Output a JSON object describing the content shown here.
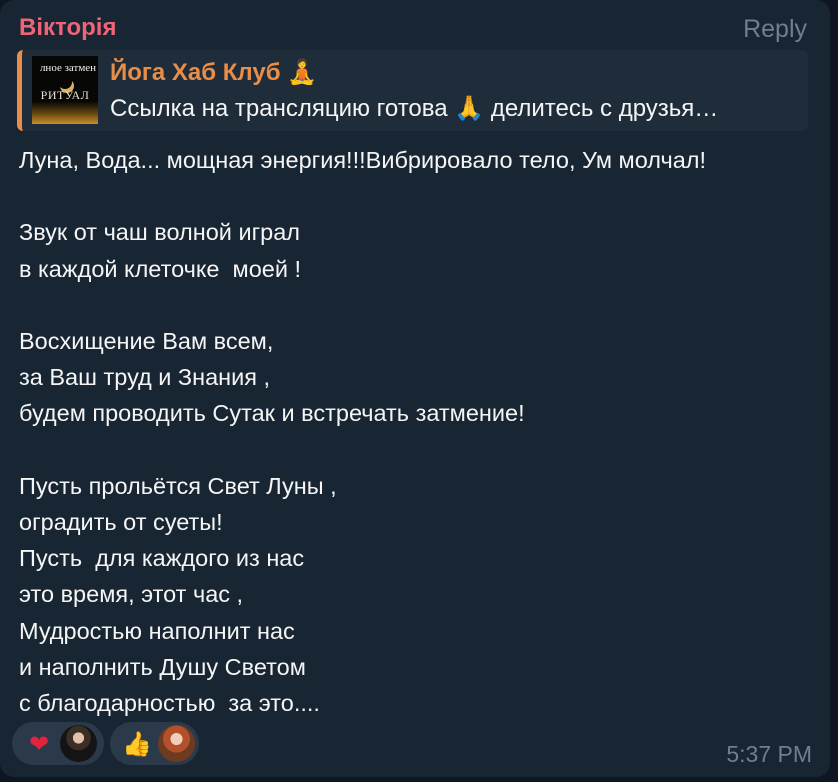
{
  "message": {
    "sender": "Вікторія",
    "reply_label": "Reply",
    "quote": {
      "thumb_caption_top": "лное затмен",
      "thumb_caption_bottom": "РИТУАЛ",
      "channel_name": "Йога Хаб Клуб",
      "channel_emoji": "🧘",
      "preview_before_emoji": "Ссылка на трансляцию готова ",
      "preview_emoji": "🙏",
      "preview_after_emoji": " делитесь с друзья…"
    },
    "text": "Луна, Вода... мощная энергия!!!Вибрировало тело, Ум молчал!\n\nЗвук от чаш волной играл\nв каждой клеточке  моей !\n\nВосхищение Вам всем,\nза Ваш труд и Знания ,\nбудем проводить Сутак и встречать затмение!\n\nПусть прольётся Свет Луны ,\nоградить от суеты!\nПусть  для каждого из нас\nэто время, этот час ,\nМудростью наполнит нас\nи наполнить Душу Светом\nс благодарностью  за это....",
    "reactions": [
      {
        "emoji": "❤",
        "icon": "heart-icon"
      },
      {
        "emoji": "👍",
        "icon": "thumbs-up-icon"
      }
    ],
    "time": "5:37 PM"
  },
  "colors": {
    "background": "#0e1621",
    "bubble": "#182533",
    "sender": "#f06479",
    "quote_accent": "#e98e49",
    "muted": "#6e7f90",
    "text": "#f5f5f5"
  }
}
